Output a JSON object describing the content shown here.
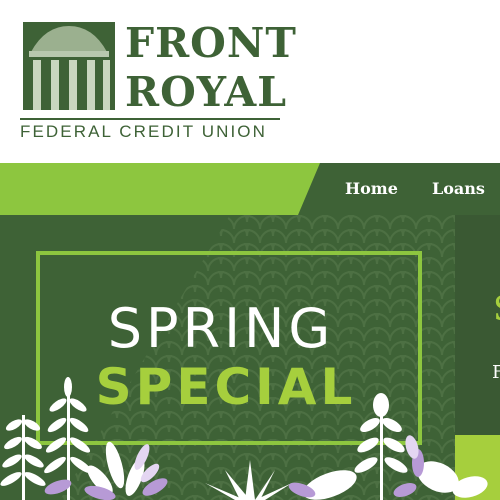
{
  "brand": {
    "name_line1": "FRONT",
    "name_line2": "ROYAL",
    "tagline": "FEDERAL CREDIT UNION",
    "logo_icon": "building-columns-icon",
    "color": "#3e6236"
  },
  "nav": {
    "items": [
      {
        "label": "Home"
      },
      {
        "label": "Loans"
      }
    ],
    "accent": "#8dc63f",
    "dark": "#3e6236"
  },
  "hero": {
    "title_line1": "SPRING",
    "title_line2": "SPECIAL",
    "side_char_1": "S",
    "side_char_2": "F",
    "title_color": "#a6cf3d"
  }
}
